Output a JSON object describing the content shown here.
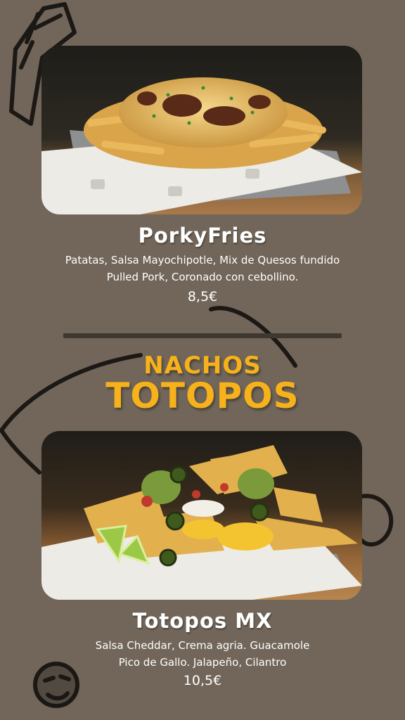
{
  "background_color": "#716659",
  "accent_color": "#f7b21b",
  "items": [
    {
      "name": "PorkyFries",
      "description_lines": [
        "Patatas, Salsa Mayochipotle, Mix de Quesos fundido",
        "Pulled Pork, Coronado con cebollino."
      ],
      "price": "8,5€",
      "photo": "loaded-fries-photo"
    },
    {
      "name": "Totopos MX",
      "description_lines": [
        "Salsa Cheddar, Crema agria. Guacamole",
        "Pico de Gallo. Jalapeño, Cilantro"
      ],
      "price": "10,5€",
      "photo": "nachos-photo"
    }
  ],
  "section": {
    "subtitle": "NACHOS",
    "title": "TOTOPOS"
  }
}
